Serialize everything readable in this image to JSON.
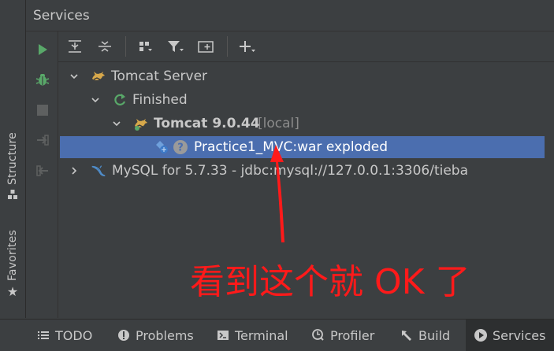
{
  "panel": {
    "title": "Services"
  },
  "side_tabs": {
    "structure": "Structure",
    "favorites": "Favorites"
  },
  "tree": {
    "tomcat_server": "Tomcat Server",
    "finished": "Finished",
    "tomcat_name": "Tomcat 9.0.44",
    "tomcat_local": "[local]",
    "artifact": "Practice1_MVC:war exploded",
    "mysql": "MySQL for 5.7.33 - jdbc:mysql://127.0.0.1:3306/tieba"
  },
  "annotation": {
    "text": "看到这个就 OK 了"
  },
  "bottom_tabs": {
    "todo": "TODO",
    "problems": "Problems",
    "terminal": "Terminal",
    "profiler": "Profiler",
    "build": "Build",
    "services": "Services"
  },
  "colors": {
    "selection": "#4b6eaf",
    "run_green": "#59a869",
    "annotation_red": "#ff1a1a",
    "background": "#3c3f41"
  }
}
